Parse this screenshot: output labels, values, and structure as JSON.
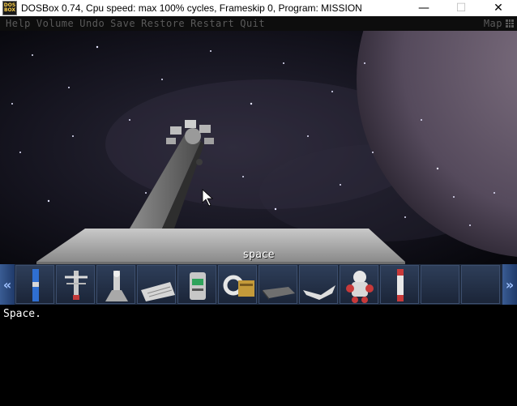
{
  "window": {
    "icon_text": [
      "DOS",
      "BOX"
    ],
    "title": "DOSBox 0.74, Cpu speed: max 100% cycles, Frameskip  0, Program:  MISSION",
    "minimize": "—",
    "maximize": "☐",
    "close": "✕"
  },
  "menu": {
    "items": [
      "Help",
      "Volume",
      "Undo",
      "Save",
      "Restore",
      "Restart",
      "Quit"
    ],
    "map_label": "Map"
  },
  "scene": {
    "label": "space"
  },
  "inventory": {
    "left_arrow": "«",
    "right_arrow": "»",
    "items": [
      "blue-rod-icon",
      "radio-antenna-icon",
      "grappling-device-icon",
      "paper-sheet-icon",
      "container-canister-icon",
      "tape-device-icon",
      "flat-plate-icon",
      "folded-cloth-icon",
      "astronaut-robot-icon",
      "red-white-rod-icon",
      "empty-slot",
      "empty-slot"
    ]
  },
  "output": {
    "text": "Space."
  }
}
